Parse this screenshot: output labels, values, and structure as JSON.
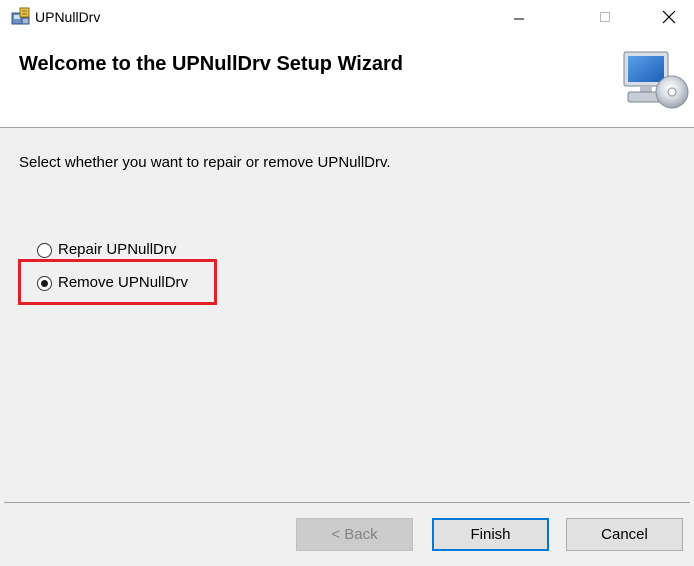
{
  "window": {
    "title": "UPNullDrv",
    "controls": {
      "minimize": "minimize-icon",
      "maximize": "maximize-icon",
      "close": "close-icon"
    }
  },
  "header": {
    "title": "Welcome to the UPNullDrv Setup Wizard",
    "graphic": "computer-cd-icon"
  },
  "body": {
    "instruction": "Select whether you want to repair or remove UPNullDrv.",
    "options": [
      {
        "label": "Repair UPNullDrv",
        "selected": false
      },
      {
        "label": "Remove UPNullDrv",
        "selected": true
      }
    ],
    "highlight_color": "#e3202a"
  },
  "footer": {
    "back_label": "< Back",
    "back_enabled": false,
    "finish_label": "Finish",
    "cancel_label": "Cancel",
    "focus_color": "#0078d7"
  }
}
